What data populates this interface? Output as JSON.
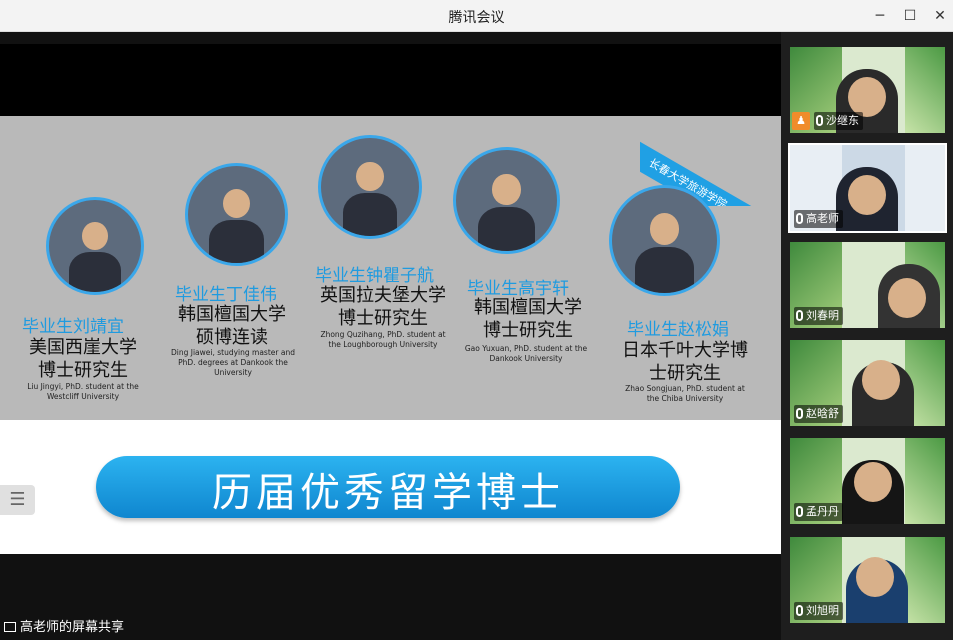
{
  "window": {
    "title": "腾讯会议"
  },
  "slide": {
    "watermark": "长春大学旅游学院",
    "banner": "历届优秀留学博士",
    "people": [
      {
        "name": "毕业生刘靖宜",
        "school": "美国西崖大学\n博士研究生",
        "english": "Liu Jingyi, PhD. student at the Westcliff University"
      },
      {
        "name": "毕业生丁佳伟",
        "school": "韩国檀国大学\n硕博连读",
        "english": "Ding Jiawei, studying master and PhD. degrees at Dankook the University"
      },
      {
        "name": "毕业生钟瞿子航",
        "school": "英国拉夫堡大学\n博士研究生",
        "english": "Zhong Quzihang, PhD. student at the Loughborough University"
      },
      {
        "name": "毕业生高宇轩",
        "school": "韩国檀国大学\n博士研究生",
        "english": "Gao Yuxuan, PhD. student at the Dankook University"
      },
      {
        "name": "毕业生赵松娟",
        "school": "日本千叶大学博\n士研究生",
        "english": "Zhao Songjuan, PhD. student at the Chiba University"
      }
    ]
  },
  "share_label": "高老师的屏幕共享",
  "participants": [
    {
      "name": "沙继东"
    },
    {
      "name": "高老师"
    },
    {
      "name": "刘春明"
    },
    {
      "name": "赵晗舒"
    },
    {
      "name": "孟丹丹"
    },
    {
      "name": "刘旭明"
    }
  ]
}
